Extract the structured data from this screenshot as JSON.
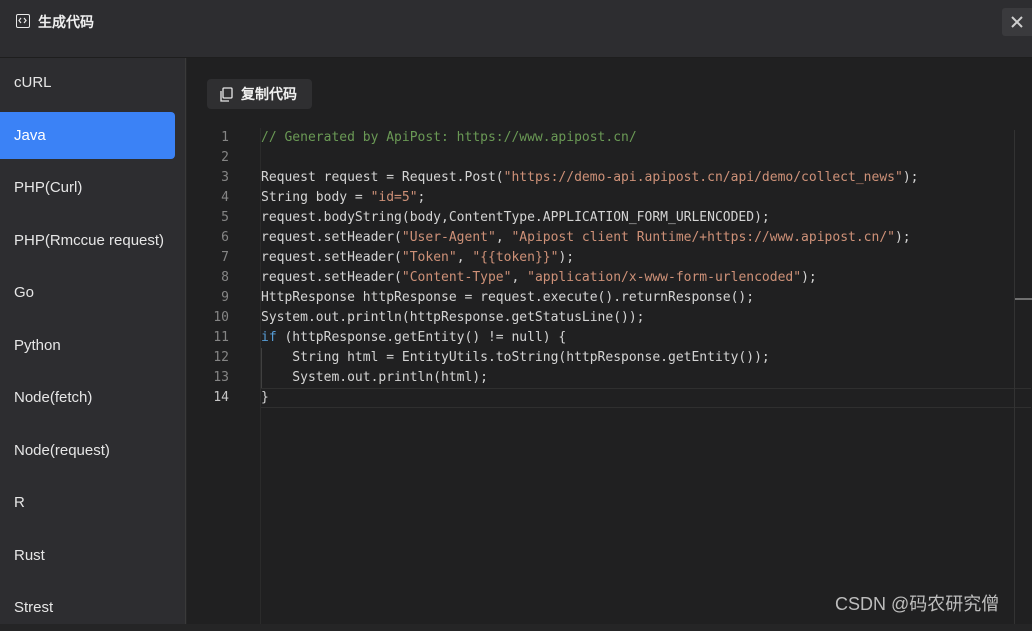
{
  "dialog": {
    "title": "生成代码",
    "title_icon": "code-brackets-icon",
    "close_icon": "close-icon"
  },
  "sidebar": {
    "items": [
      {
        "label": "cURL",
        "active": false
      },
      {
        "label": "Java",
        "active": true
      },
      {
        "label": "PHP(Curl)",
        "active": false
      },
      {
        "label": "PHP(Rmccue request)",
        "active": false
      },
      {
        "label": "Go",
        "active": false
      },
      {
        "label": "Python",
        "active": false
      },
      {
        "label": "Node(fetch)",
        "active": false
      },
      {
        "label": "Node(request)",
        "active": false
      },
      {
        "label": "R",
        "active": false
      },
      {
        "label": "Rust",
        "active": false
      },
      {
        "label": "Strest",
        "active": false
      }
    ],
    "active_color": "#3b82f6"
  },
  "toolbar": {
    "copy_label": "复制代码",
    "copy_icon": "copy-icon"
  },
  "editor": {
    "current_line": 14,
    "lines": [
      {
        "n": "1",
        "tokens": [
          {
            "t": "// Generated by ApiPost: https://www.apipost.cn/",
            "c": "cm"
          }
        ]
      },
      {
        "n": "2",
        "tokens": []
      },
      {
        "n": "3",
        "tokens": [
          {
            "t": "Request request = Request.Post(",
            "c": ""
          },
          {
            "t": "\"https://demo-api.apipost.cn/api/demo/collect_news\"",
            "c": "st"
          },
          {
            "t": ");",
            "c": ""
          }
        ]
      },
      {
        "n": "4",
        "tokens": [
          {
            "t": "String body = ",
            "c": ""
          },
          {
            "t": "\"id=5\"",
            "c": "st"
          },
          {
            "t": ";",
            "c": ""
          }
        ]
      },
      {
        "n": "5",
        "tokens": [
          {
            "t": "request.bodyString(body,ContentType.APPLICATION_FORM_URLENCODED);",
            "c": ""
          }
        ]
      },
      {
        "n": "6",
        "tokens": [
          {
            "t": "request.setHeader(",
            "c": ""
          },
          {
            "t": "\"User-Agent\"",
            "c": "st"
          },
          {
            "t": ", ",
            "c": ""
          },
          {
            "t": "\"Apipost client Runtime/+https://www.apipost.cn/\"",
            "c": "st"
          },
          {
            "t": ");",
            "c": ""
          }
        ]
      },
      {
        "n": "7",
        "tokens": [
          {
            "t": "request.setHeader(",
            "c": ""
          },
          {
            "t": "\"Token\"",
            "c": "st"
          },
          {
            "t": ", ",
            "c": ""
          },
          {
            "t": "\"{{token}}\"",
            "c": "st"
          },
          {
            "t": ");",
            "c": ""
          }
        ]
      },
      {
        "n": "8",
        "tokens": [
          {
            "t": "request.setHeader(",
            "c": ""
          },
          {
            "t": "\"Content-Type\"",
            "c": "st"
          },
          {
            "t": ", ",
            "c": ""
          },
          {
            "t": "\"application/x-www-form-urlencoded\"",
            "c": "st"
          },
          {
            "t": ");",
            "c": ""
          }
        ]
      },
      {
        "n": "9",
        "tokens": [
          {
            "t": "HttpResponse httpResponse = request.execute().returnResponse();",
            "c": ""
          }
        ]
      },
      {
        "n": "10",
        "tokens": [
          {
            "t": "System.out.println(httpResponse.getStatusLine());",
            "c": ""
          }
        ]
      },
      {
        "n": "11",
        "tokens": [
          {
            "t": "if",
            "c": "kw"
          },
          {
            "t": " (httpResponse.getEntity() != null) {",
            "c": ""
          }
        ]
      },
      {
        "n": "12",
        "tokens": [
          {
            "t": "    String html = EntityUtils.toString(httpResponse.getEntity());",
            "c": ""
          }
        ]
      },
      {
        "n": "13",
        "tokens": [
          {
            "t": "    System.out.println(html);",
            "c": ""
          }
        ]
      },
      {
        "n": "14",
        "tokens": [
          {
            "t": "}",
            "c": ""
          }
        ]
      }
    ]
  },
  "watermark": "CSDN @码农研究僧"
}
